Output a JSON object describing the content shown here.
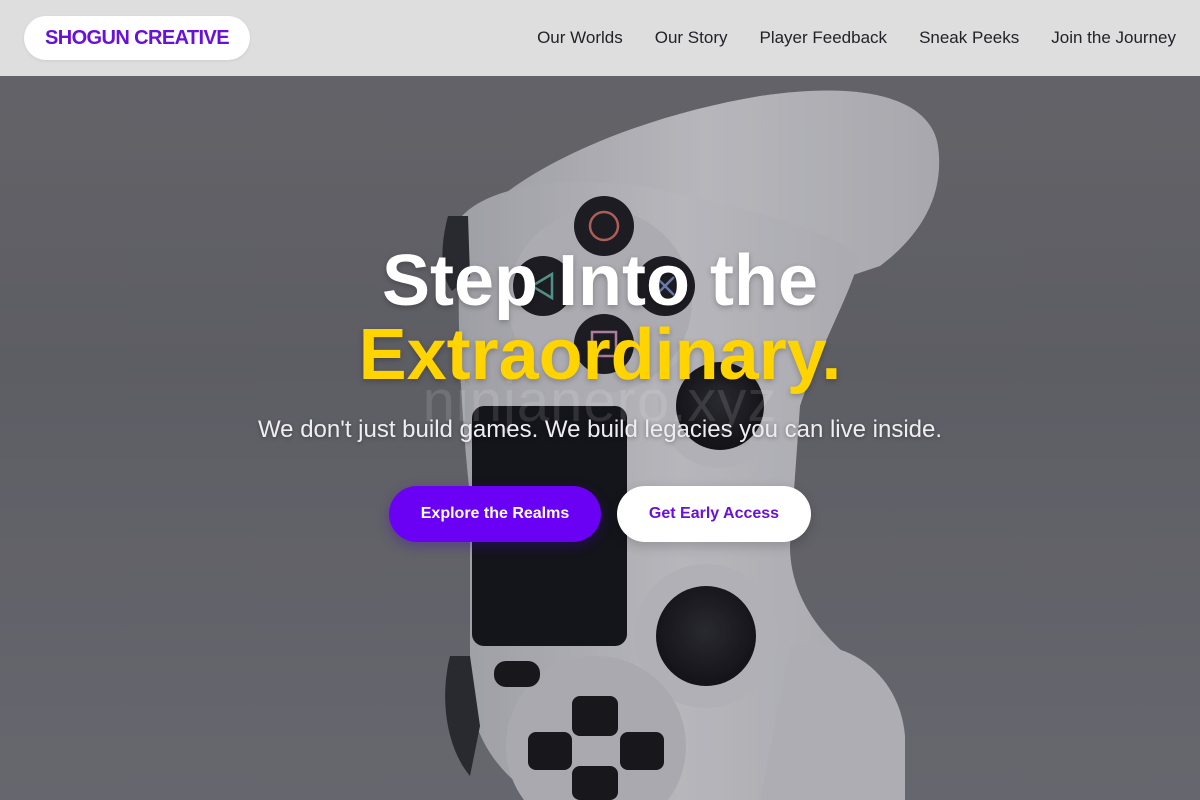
{
  "brand": {
    "name": "SHOGUN CREATIVE"
  },
  "nav": {
    "items": [
      {
        "label": "Our Worlds"
      },
      {
        "label": "Our Story"
      },
      {
        "label": "Player Feedback"
      },
      {
        "label": "Sneak Peeks"
      },
      {
        "label": "Join the Journey"
      }
    ]
  },
  "hero": {
    "headline_line1": "Step Into the",
    "headline_line2": "Extraordinary.",
    "subtitle": "We don't just build games. We build legacies you can live inside.",
    "watermark": "ninjanero.xyz",
    "primary_cta": "Explore the Realms",
    "secondary_cta": "Get Early Access",
    "background_image": "white-game-controller-photo"
  },
  "colors": {
    "brand_purple": "#6a10d8",
    "primary_button": "#6a00f4",
    "accent_yellow": "#ffd400",
    "header_bg": "#dedede"
  }
}
